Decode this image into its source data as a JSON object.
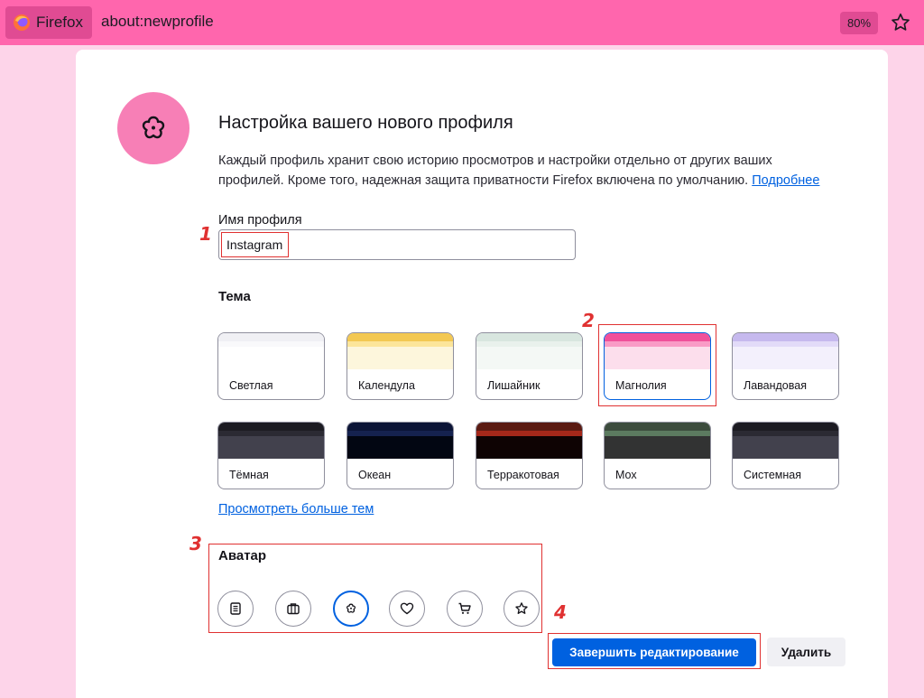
{
  "browser": {
    "identity_label": "Firefox",
    "url": "about:newprofile",
    "zoom": "80%"
  },
  "profile": {
    "title": "Настройка вашего нового профиля",
    "description": "Каждый профиль хранит свою историю просмотров и настройки отдельно от других ваших профилей. Кроме того, надежная защита приватности Firefox включена по умолчанию.",
    "learn_more": "Подробнее",
    "name_label": "Имя профиля",
    "name_value": "Instagram"
  },
  "theme": {
    "heading": "Тема",
    "more_link": "Просмотреть больше тем",
    "selected": "Магнолия",
    "items": [
      {
        "label": "Светлая",
        "colors": [
          "#f0f0f4",
          "#f9f9fb",
          "#ffffff"
        ]
      },
      {
        "label": "Календула",
        "colors": [
          "#f3c852",
          "#fce59a",
          "#fdf6dc"
        ]
      },
      {
        "label": "Лишайник",
        "colors": [
          "#d8e6df",
          "#e9f1ec",
          "#f4f8f5"
        ]
      },
      {
        "label": "Магнолия",
        "colors": [
          "#f0509a",
          "#f99bc6",
          "#fcdeec"
        ]
      },
      {
        "label": "Лавандовая",
        "colors": [
          "#c6b9ee",
          "#e2dbf8",
          "#f3f0fc"
        ]
      },
      {
        "label": "Тёмная",
        "colors": [
          "#1c1b22",
          "#2b2a33",
          "#42414d"
        ]
      },
      {
        "label": "Океан",
        "colors": [
          "#0b1436",
          "#15224f",
          "#020612"
        ]
      },
      {
        "label": "Терракотовая",
        "colors": [
          "#5a1a12",
          "#a4281a",
          "#0e0303"
        ]
      },
      {
        "label": "Мох",
        "colors": [
          "#3c4c3d",
          "#5c7b60",
          "#323333"
        ]
      },
      {
        "label": "Системная",
        "colors": [
          "#1c1b22",
          "#2b2a33",
          "#42414d"
        ]
      }
    ]
  },
  "avatar": {
    "heading": "Аватар",
    "selected": "flower",
    "items": [
      "book",
      "briefcase",
      "flower",
      "heart",
      "shopping-cart",
      "star"
    ]
  },
  "actions": {
    "done_label": "Завершить редактирование",
    "delete_label": "Удалить"
  },
  "annotations": [
    "1",
    "2",
    "3",
    "4"
  ],
  "colors": {
    "accent": "#0061e0",
    "toolbar": "#ff66ad",
    "page_bg": "#fdd4e9",
    "annotation": "#e03131"
  }
}
